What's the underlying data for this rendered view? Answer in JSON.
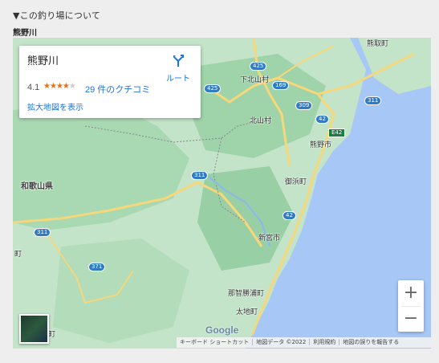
{
  "section_title": "▼この釣り場について",
  "place_name": "熊野川",
  "card": {
    "name": "熊野川",
    "rating": "4.1",
    "stars_filled": 4,
    "stars_total": 5,
    "reviews": "29 件のクチコミ",
    "route_label": "ルート",
    "enlarge": "拡大地図を表示"
  },
  "map": {
    "labels": {
      "shimokitayama": "下北山村",
      "kitayama": "北山村",
      "kumano": "熊野市",
      "mihama": "御浜町",
      "wakayama_pref": "和歌山県",
      "shingu": "新宮市",
      "nachikatsuura": "那智勝浦町",
      "taiji": "太地町",
      "kumatori": "熊取町",
      "cho_left": "町",
      "cho_left2": "町"
    },
    "shields": {
      "r425a": "425",
      "r425b": "425",
      "r169": "169",
      "r309": "309",
      "r311a": "311",
      "r311b": "311",
      "r311c": "311",
      "r371": "371",
      "r42a": "42",
      "r42b": "42",
      "e42": "E42"
    },
    "colors": {
      "sea": "#a7c7f7",
      "land": "#bde2c4",
      "forest": "#8fcf9e",
      "road": "#f6d77a"
    }
  },
  "zoom": {
    "plus": "+",
    "minus": "−"
  },
  "logo": "Google",
  "footer": {
    "shortcuts": "キーボード ショートカット",
    "map_data": "地図データ ©2022",
    "terms": "利用規約",
    "report": "地図の誤りを報告する"
  }
}
